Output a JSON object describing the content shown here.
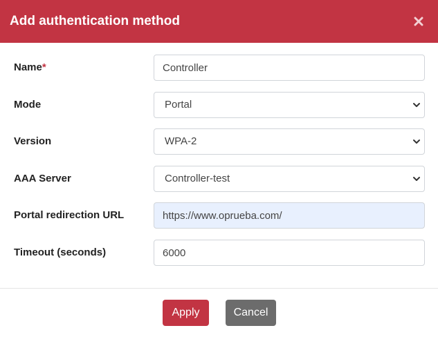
{
  "dialog": {
    "title": "Add authentication method",
    "close_label": "×"
  },
  "form": {
    "name": {
      "label": "Name",
      "required_mark": "*",
      "value": "Controller"
    },
    "mode": {
      "label": "Mode",
      "selected": "Portal"
    },
    "version": {
      "label": "Version",
      "selected": "WPA-2"
    },
    "aaa_server": {
      "label": "AAA Server",
      "selected": "Controller-test"
    },
    "portal_url": {
      "label": "Portal redirection URL",
      "value": "https://www.oprueba.com/"
    },
    "timeout": {
      "label": "Timeout (seconds)",
      "value": "6000"
    }
  },
  "footer": {
    "apply_label": "Apply",
    "cancel_label": "Cancel"
  },
  "colors": {
    "primary": "#c23443",
    "secondary": "#6c6c6c",
    "autofill_bg": "#e8f0fe"
  },
  "icons": {
    "close": "close-icon",
    "dropdown": "chevron-down-icon"
  }
}
